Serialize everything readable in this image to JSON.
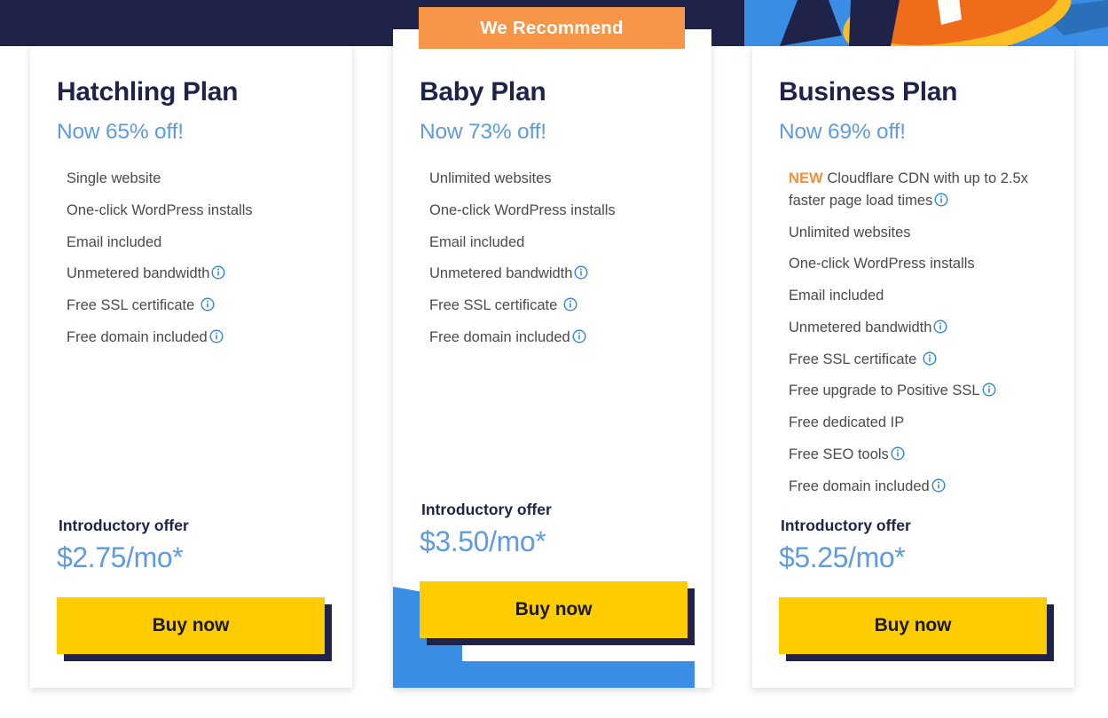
{
  "colors": {
    "navy": "#1f2249",
    "accent_blue": "#5f9bdd",
    "bright_blue": "#3a8ee6",
    "orange": "#f79548",
    "new_orange": "#f2903b",
    "yellow": "#ffcc00",
    "feature_text": "#4a4a4a"
  },
  "hero": {
    "illustration_name": "cartoon-hero-illustration"
  },
  "recommend_banner": {
    "label": "We Recommend"
  },
  "plans": [
    {
      "name": "Hatchling Plan",
      "discount": "Now 65% off!",
      "features": [
        {
          "text": "Single website",
          "info": false,
          "new": false
        },
        {
          "text": "One-click WordPress installs",
          "info": false,
          "new": false
        },
        {
          "text": "Email included",
          "info": false,
          "new": false
        },
        {
          "text": "Unmetered bandwidth",
          "info": true,
          "new": false
        },
        {
          "text": "Free SSL certificate ",
          "info": true,
          "new": false
        },
        {
          "text": "Free domain included",
          "info": true,
          "new": false
        }
      ],
      "offer_label": "Introductory offer",
      "price": "$2.75/mo*",
      "buy_label": "Buy now",
      "recommended": false
    },
    {
      "name": "Baby Plan",
      "discount": "Now 73% off!",
      "features": [
        {
          "text": "Unlimited websites",
          "info": false,
          "new": false
        },
        {
          "text": "One-click WordPress installs",
          "info": false,
          "new": false
        },
        {
          "text": "Email included",
          "info": false,
          "new": false
        },
        {
          "text": "Unmetered bandwidth",
          "info": true,
          "new": false
        },
        {
          "text": "Free SSL certificate ",
          "info": true,
          "new": false
        },
        {
          "text": "Free domain included",
          "info": true,
          "new": false
        }
      ],
      "offer_label": "Introductory offer",
      "price": "$3.50/mo*",
      "buy_label": "Buy now",
      "recommended": true
    },
    {
      "name": "Business Plan",
      "discount": "Now 69% off!",
      "features": [
        {
          "text": "Cloudflare CDN with up to 2.5x faster page load times",
          "info": true,
          "new": true,
          "new_label": "NEW"
        },
        {
          "text": "Unlimited websites",
          "info": false,
          "new": false
        },
        {
          "text": "One-click WordPress installs",
          "info": false,
          "new": false
        },
        {
          "text": "Email included",
          "info": false,
          "new": false
        },
        {
          "text": "Unmetered bandwidth",
          "info": true,
          "new": false
        },
        {
          "text": "Free SSL certificate ",
          "info": true,
          "new": false
        },
        {
          "text": "Free upgrade to Positive SSL",
          "info": true,
          "new": false
        },
        {
          "text": "Free dedicated IP",
          "info": false,
          "new": false
        },
        {
          "text": "Free SEO tools",
          "info": true,
          "new": false
        },
        {
          "text": "Free domain included",
          "info": true,
          "new": false
        }
      ],
      "offer_label": "Introductory offer",
      "price": "$5.25/mo*",
      "buy_label": "Buy now",
      "recommended": false
    }
  ]
}
